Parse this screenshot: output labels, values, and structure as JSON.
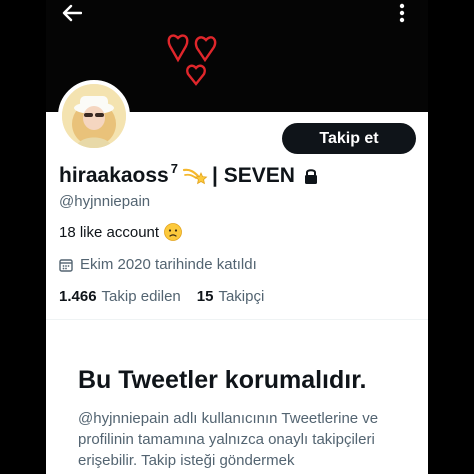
{
  "header": {
    "back_icon": "arrow-left-icon",
    "more_icon": "vertical-dots-icon"
  },
  "banner": {
    "decoration": "red-hearts-doodle",
    "colors": {
      "background": "#050505",
      "hearts": "#e0262b"
    }
  },
  "profile": {
    "display_name": "hiraakaoss",
    "superscript": "7",
    "name_suffix": "| SEVEN",
    "name_emoji": "dizzy-comet-icon",
    "lock_icon": "lock-icon",
    "handle": "@hyjnniepain",
    "bio": "18 like account",
    "bio_emoji": "slightly-frowning-face-icon",
    "joined_icon": "calendar-icon",
    "joined": "Ekim 2020 tarihinde katıldı",
    "follow_label": "Takip et",
    "stats": [
      {
        "number": "1.466",
        "label": "Takip edilen"
      },
      {
        "number": "15",
        "label": "Takipçi"
      }
    ]
  },
  "protected_notice": {
    "title": "Bu Tweetler korumalıdır.",
    "body": "@hyjnniepain adlı kullanıcının Tweetlerine ve profilinin tamamına yalnızca onaylı takipçileri erişebilir. Takip isteği göndermek"
  },
  "colors": {
    "primary_text": "#0f1419",
    "secondary_text": "#536471",
    "button_bg": "#0f1419",
    "card_bg": "#ffffff",
    "page_bg": "#000000"
  }
}
